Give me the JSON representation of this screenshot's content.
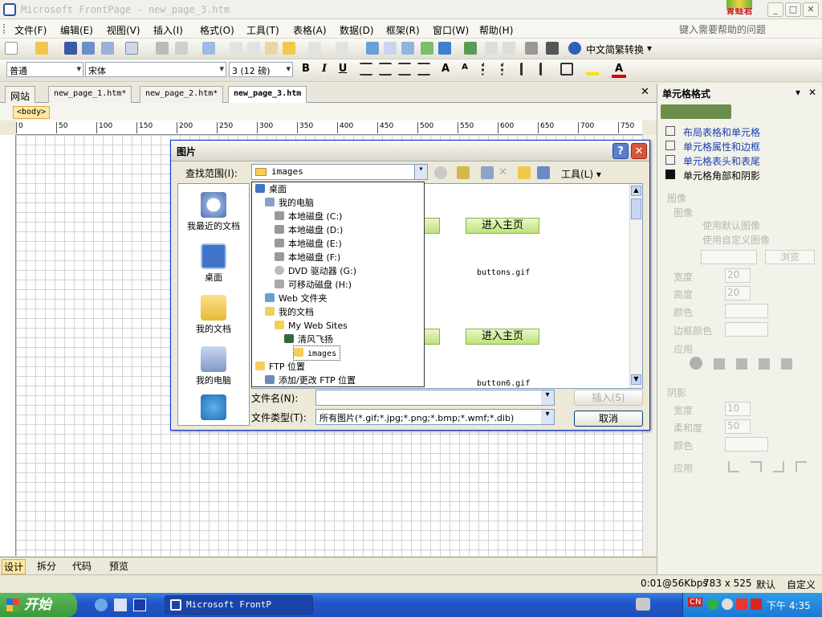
{
  "window": {
    "title": "Microsoft FrontPage - new_page_3.htm",
    "logo_text": "青蛙君"
  },
  "menu": {
    "items": [
      "文件(F)",
      "编辑(E)",
      "视图(V)",
      "插入(I)",
      "格式(O)",
      "工具(T)",
      "表格(A)",
      "数据(D)",
      "框架(R)",
      "窗口(W)",
      "帮助(H)"
    ],
    "help_placeholder": "键入需要帮助的问题"
  },
  "toolbar": {
    "convert_label": "中文简繁转换"
  },
  "format_bar": {
    "style": "普通",
    "font": "宋体",
    "size": "3 (12 磅)",
    "bold": "B",
    "italic": "I",
    "underline": "U",
    "font_color": "A"
  },
  "tabs": {
    "site": "网站",
    "items": [
      "new_page_1.htm*",
      "new_page_2.htm*",
      "new_page_3.htm"
    ],
    "active": 2
  },
  "body_tag": "<body>",
  "ruler": {
    "marks": [
      "0",
      "50",
      "100",
      "150",
      "200",
      "250",
      "300",
      "350",
      "400",
      "450",
      "500",
      "550",
      "600",
      "650",
      "700",
      "750"
    ]
  },
  "view_tabs": [
    "设计",
    "拆分",
    "代码",
    "预览"
  ],
  "status": {
    "speed": "0:01@56Kbps",
    "size": "783 x 525",
    "mode1": "默认",
    "mode2": "自定义"
  },
  "taskbar": {
    "start": "开始",
    "task": "Microsoft FrontP",
    "clock": "下午 4:35",
    "lang": "CN"
  },
  "panel": {
    "title": "单元格格式",
    "links": [
      "布局表格和单元格",
      "单元格属性和边框",
      "单元格表头和表尾",
      "单元格角部和阴影"
    ],
    "section_images": "图像",
    "group_image": "图像",
    "radio1": "使用默认图像",
    "radio2": "使用自定义图像",
    "browse": "浏览",
    "width_label": "宽度",
    "height_label": "高度",
    "width_value": "20",
    "height_value": "20",
    "color_label": "颜色",
    "border_color_label": "边框颜色",
    "apply_label": "应用",
    "section_shadow": "阴影",
    "shadow_width_label": "宽度",
    "shadow_softness_label": "柔和度",
    "shadow_color_label": "颜色",
    "shadow_apply_label": "应用",
    "shadow_width_value": "10",
    "shadow_softness_value": "50"
  },
  "dialog": {
    "title": "图片",
    "look_in_label": "查找范围(I):",
    "look_in_value": "images",
    "tools_label": "工具(L)",
    "places": [
      "我最近的文档",
      "桌面",
      "我的文档",
      "我的电脑"
    ],
    "dropdown": [
      "桌面",
      "我的电脑",
      "本地磁盘 (C:)",
      "本地磁盘 (D:)",
      "本地磁盘 (E:)",
      "本地磁盘 (F:)",
      "DVD 驱动器 (G:)",
      "可移动磁盘 (H:)",
      "Web 文件夹",
      "我的文档",
      "My Web Sites",
      "清风飞扬",
      "images",
      "FTP 位置",
      "添加/更改 FTP 位置"
    ],
    "thumb_label": "进入主页",
    "files": [
      "buttons.gif",
      "button6.gif"
    ],
    "file_name_label": "文件名(N):",
    "file_type_label": "文件类型(T):",
    "file_type_value": "所有图片(*.gif;*.jpg;*.png;*.bmp;*.wmf;*.dib)",
    "insert_button": "插入(S)",
    "cancel_button": "取消",
    "help_button": "?",
    "close_button": "✕"
  }
}
